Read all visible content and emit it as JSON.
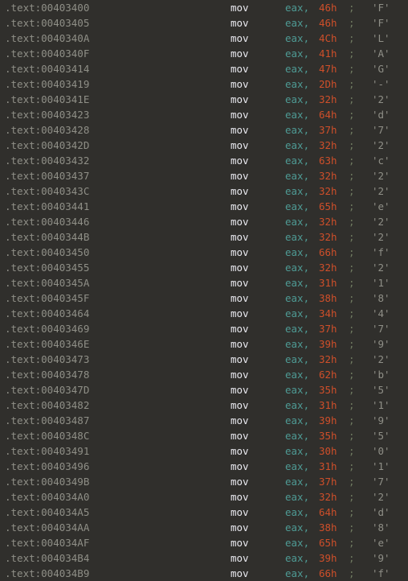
{
  "view": {
    "name": "disassembly-listing",
    "segment": "'.text'",
    "background_color": "#302f2c",
    "colors": {
      "address": "#8f8f87",
      "mnemonic": "#e8e8ee",
      "register": "#4e9a94",
      "immediate": "#cf4f2a",
      "comment_semicolon": "#6f7a60",
      "comment_char": "#8f8f87"
    }
  },
  "rows": [
    {
      "address": ".text:00403400",
      "mnemonic": "mov",
      "operand": "eax,",
      "immediate": "46h",
      "semicolon": ";",
      "char": "'F'"
    },
    {
      "address": ".text:00403405",
      "mnemonic": "mov",
      "operand": "eax,",
      "immediate": "46h",
      "semicolon": ";",
      "char": "'F'"
    },
    {
      "address": ".text:0040340A",
      "mnemonic": "mov",
      "operand": "eax,",
      "immediate": "4Ch",
      "semicolon": ";",
      "char": "'L'"
    },
    {
      "address": ".text:0040340F",
      "mnemonic": "mov",
      "operand": "eax,",
      "immediate": "41h",
      "semicolon": ";",
      "char": "'A'"
    },
    {
      "address": ".text:00403414",
      "mnemonic": "mov",
      "operand": "eax,",
      "immediate": "47h",
      "semicolon": ";",
      "char": "'G'"
    },
    {
      "address": ".text:00403419",
      "mnemonic": "mov",
      "operand": "eax,",
      "immediate": "2Dh",
      "semicolon": ";",
      "char": "'-'"
    },
    {
      "address": ".text:0040341E",
      "mnemonic": "mov",
      "operand": "eax,",
      "immediate": "32h",
      "semicolon": ";",
      "char": "'2'"
    },
    {
      "address": ".text:00403423",
      "mnemonic": "mov",
      "operand": "eax,",
      "immediate": "64h",
      "semicolon": ";",
      "char": "'d'"
    },
    {
      "address": ".text:00403428",
      "mnemonic": "mov",
      "operand": "eax,",
      "immediate": "37h",
      "semicolon": ";",
      "char": "'7'"
    },
    {
      "address": ".text:0040342D",
      "mnemonic": "mov",
      "operand": "eax,",
      "immediate": "32h",
      "semicolon": ";",
      "char": "'2'"
    },
    {
      "address": ".text:00403432",
      "mnemonic": "mov",
      "operand": "eax,",
      "immediate": "63h",
      "semicolon": ";",
      "char": "'c'"
    },
    {
      "address": ".text:00403437",
      "mnemonic": "mov",
      "operand": "eax,",
      "immediate": "32h",
      "semicolon": ";",
      "char": "'2'"
    },
    {
      "address": ".text:0040343C",
      "mnemonic": "mov",
      "operand": "eax,",
      "immediate": "32h",
      "semicolon": ";",
      "char": "'2'"
    },
    {
      "address": ".text:00403441",
      "mnemonic": "mov",
      "operand": "eax,",
      "immediate": "65h",
      "semicolon": ";",
      "char": "'e'"
    },
    {
      "address": ".text:00403446",
      "mnemonic": "mov",
      "operand": "eax,",
      "immediate": "32h",
      "semicolon": ";",
      "char": "'2'"
    },
    {
      "address": ".text:0040344B",
      "mnemonic": "mov",
      "operand": "eax,",
      "immediate": "32h",
      "semicolon": ";",
      "char": "'2'"
    },
    {
      "address": ".text:00403450",
      "mnemonic": "mov",
      "operand": "eax,",
      "immediate": "66h",
      "semicolon": ";",
      "char": "'f'"
    },
    {
      "address": ".text:00403455",
      "mnemonic": "mov",
      "operand": "eax,",
      "immediate": "32h",
      "semicolon": ";",
      "char": "'2'"
    },
    {
      "address": ".text:0040345A",
      "mnemonic": "mov",
      "operand": "eax,",
      "immediate": "31h",
      "semicolon": ";",
      "char": "'1'"
    },
    {
      "address": ".text:0040345F",
      "mnemonic": "mov",
      "operand": "eax,",
      "immediate": "38h",
      "semicolon": ";",
      "char": "'8'"
    },
    {
      "address": ".text:00403464",
      "mnemonic": "mov",
      "operand": "eax,",
      "immediate": "34h",
      "semicolon": ";",
      "char": "'4'"
    },
    {
      "address": ".text:00403469",
      "mnemonic": "mov",
      "operand": "eax,",
      "immediate": "37h",
      "semicolon": ";",
      "char": "'7'"
    },
    {
      "address": ".text:0040346E",
      "mnemonic": "mov",
      "operand": "eax,",
      "immediate": "39h",
      "semicolon": ";",
      "char": "'9'"
    },
    {
      "address": ".text:00403473",
      "mnemonic": "mov",
      "operand": "eax,",
      "immediate": "32h",
      "semicolon": ";",
      "char": "'2'"
    },
    {
      "address": ".text:00403478",
      "mnemonic": "mov",
      "operand": "eax,",
      "immediate": "62h",
      "semicolon": ";",
      "char": "'b'"
    },
    {
      "address": ".text:0040347D",
      "mnemonic": "mov",
      "operand": "eax,",
      "immediate": "35h",
      "semicolon": ";",
      "char": "'5'"
    },
    {
      "address": ".text:00403482",
      "mnemonic": "mov",
      "operand": "eax,",
      "immediate": "31h",
      "semicolon": ";",
      "char": "'1'"
    },
    {
      "address": ".text:00403487",
      "mnemonic": "mov",
      "operand": "eax,",
      "immediate": "39h",
      "semicolon": ";",
      "char": "'9'"
    },
    {
      "address": ".text:0040348C",
      "mnemonic": "mov",
      "operand": "eax,",
      "immediate": "35h",
      "semicolon": ";",
      "char": "'5'"
    },
    {
      "address": ".text:00403491",
      "mnemonic": "mov",
      "operand": "eax,",
      "immediate": "30h",
      "semicolon": ";",
      "char": "'0'"
    },
    {
      "address": ".text:00403496",
      "mnemonic": "mov",
      "operand": "eax,",
      "immediate": "31h",
      "semicolon": ";",
      "char": "'1'"
    },
    {
      "address": ".text:0040349B",
      "mnemonic": "mov",
      "operand": "eax,",
      "immediate": "37h",
      "semicolon": ";",
      "char": "'7'"
    },
    {
      "address": ".text:004034A0",
      "mnemonic": "mov",
      "operand": "eax,",
      "immediate": "32h",
      "semicolon": ";",
      "char": "'2'"
    },
    {
      "address": ".text:004034A5",
      "mnemonic": "mov",
      "operand": "eax,",
      "immediate": "64h",
      "semicolon": ";",
      "char": "'d'"
    },
    {
      "address": ".text:004034AA",
      "mnemonic": "mov",
      "operand": "eax,",
      "immediate": "38h",
      "semicolon": ";",
      "char": "'8'"
    },
    {
      "address": ".text:004034AF",
      "mnemonic": "mov",
      "operand": "eax,",
      "immediate": "65h",
      "semicolon": ";",
      "char": "'e'"
    },
    {
      "address": ".text:004034B4",
      "mnemonic": "mov",
      "operand": "eax,",
      "immediate": "39h",
      "semicolon": ";",
      "char": "'9'"
    },
    {
      "address": ".text:004034B9",
      "mnemonic": "mov",
      "operand": "eax,",
      "immediate": "66h",
      "semicolon": ";",
      "char": "'f'"
    }
  ]
}
